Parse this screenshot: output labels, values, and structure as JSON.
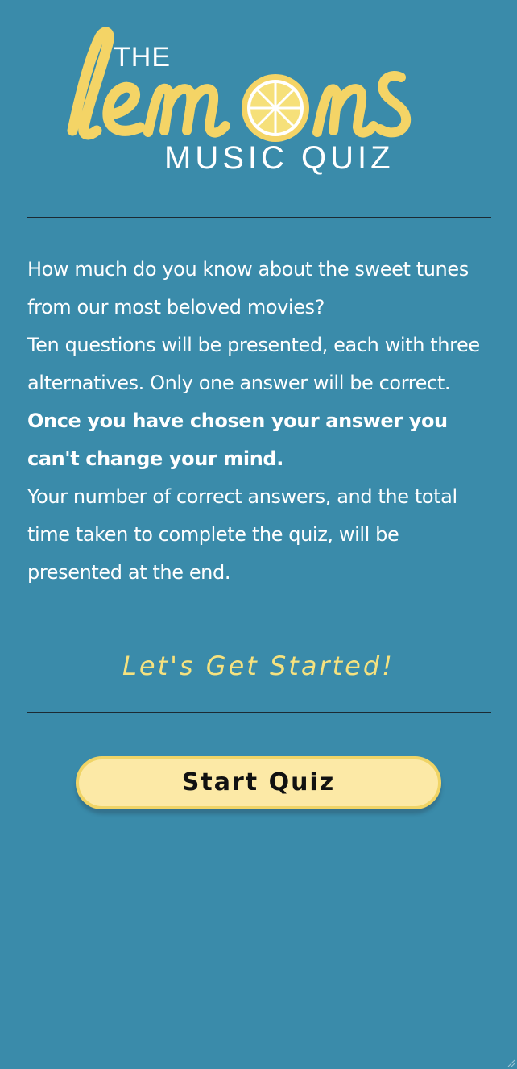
{
  "logo": {
    "the": "THE",
    "script_word": "lemons",
    "subtitle": "MUSIC QUIZ"
  },
  "intro": {
    "paragraph1": "How much do you know about the sweet tunes from our most beloved movies?",
    "paragraph2": "Ten questions will be presented, each with three alternatives. Only one answer will be correct.",
    "paragraph3_strong": "Once you have chosen your answer you can't change your mind.",
    "paragraph4": "Your number of correct answers, and the total time taken to complete the quiz, will be presented at the end."
  },
  "tagline": "Let's Get Started!",
  "start_button": {
    "label": "Start Quiz"
  },
  "colors": {
    "background": "#3a8baa",
    "lemon_yellow": "#f4d466",
    "button_fill": "#fce9a6",
    "tagline": "#f6e27f"
  },
  "icons": {
    "logo_lemon": "lemon-slice-icon",
    "grip": "resize-grip-icon"
  }
}
